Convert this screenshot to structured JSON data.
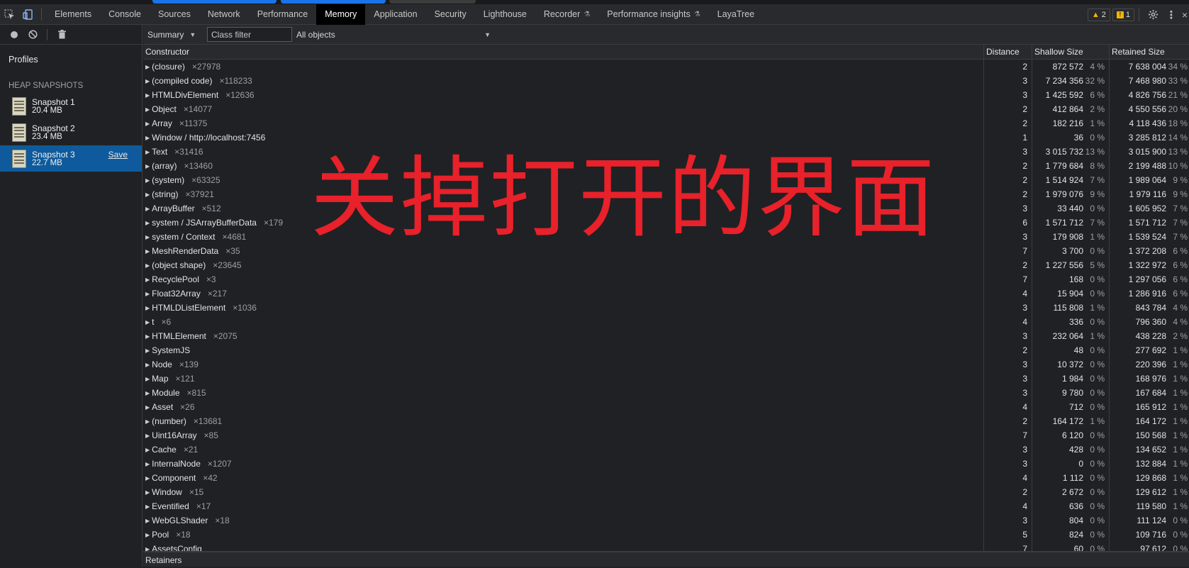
{
  "toolbar": {
    "tabs": [
      {
        "label": "Elements",
        "active": false
      },
      {
        "label": "Console",
        "active": false
      },
      {
        "label": "Sources",
        "active": false
      },
      {
        "label": "Network",
        "active": false
      },
      {
        "label": "Performance",
        "active": false
      },
      {
        "label": "Memory",
        "active": true
      },
      {
        "label": "Application",
        "active": false
      },
      {
        "label": "Security",
        "active": false
      },
      {
        "label": "Lighthouse",
        "active": false
      },
      {
        "label": "Recorder",
        "active": false
      },
      {
        "label": "Performance insights",
        "active": false
      },
      {
        "label": "LayaTree",
        "active": false
      }
    ],
    "warnings_count": "2",
    "issues_count": "1"
  },
  "sidebar": {
    "profiles_title": "Profiles",
    "section_title": "HEAP SNAPSHOTS",
    "snapshots": [
      {
        "name": "Snapshot 1",
        "size": "20.4 MB"
      },
      {
        "name": "Snapshot 2",
        "size": "23.4 MB"
      },
      {
        "name": "Snapshot 3",
        "size": "22.7 MB"
      }
    ],
    "save_label": "Save"
  },
  "filters": {
    "view": "Summary",
    "class_filter_placeholder": "Class filter",
    "objects": "All objects"
  },
  "grid": {
    "headers": {
      "constructor": "Constructor",
      "distance": "Distance",
      "shallow": "Shallow Size",
      "retained": "Retained Size"
    },
    "rows": [
      {
        "name": "(closure)",
        "count": "×27978",
        "distance": "2",
        "shallow": "872 572",
        "shallow_pct": "4 %",
        "retained": "7 638 004",
        "retained_pct": "34 %"
      },
      {
        "name": "(compiled code)",
        "count": "×118233",
        "distance": "3",
        "shallow": "7 234 356",
        "shallow_pct": "32 %",
        "retained": "7 468 980",
        "retained_pct": "33 %"
      },
      {
        "name": "HTMLDivElement",
        "count": "×12636",
        "distance": "3",
        "shallow": "1 425 592",
        "shallow_pct": "6 %",
        "retained": "4 826 756",
        "retained_pct": "21 %"
      },
      {
        "name": "Object",
        "count": "×14077",
        "distance": "2",
        "shallow": "412 864",
        "shallow_pct": "2 %",
        "retained": "4 550 556",
        "retained_pct": "20 %"
      },
      {
        "name": "Array",
        "count": "×11375",
        "distance": "2",
        "shallow": "182 216",
        "shallow_pct": "1 %",
        "retained": "4 118 436",
        "retained_pct": "18 %"
      },
      {
        "name": "Window / http://localhost:7456",
        "count": "",
        "distance": "1",
        "shallow": "36",
        "shallow_pct": "0 %",
        "retained": "3 285 812",
        "retained_pct": "14 %"
      },
      {
        "name": "Text",
        "count": "×31416",
        "distance": "3",
        "shallow": "3 015 732",
        "shallow_pct": "13 %",
        "retained": "3 015 900",
        "retained_pct": "13 %"
      },
      {
        "name": "(array)",
        "count": "×13460",
        "distance": "2",
        "shallow": "1 779 684",
        "shallow_pct": "8 %",
        "retained": "2 199 488",
        "retained_pct": "10 %"
      },
      {
        "name": "(system)",
        "count": "×63325",
        "distance": "2",
        "shallow": "1 514 924",
        "shallow_pct": "7 %",
        "retained": "1 989 064",
        "retained_pct": "9 %"
      },
      {
        "name": "(string)",
        "count": "×37921",
        "distance": "2",
        "shallow": "1 979 076",
        "shallow_pct": "9 %",
        "retained": "1 979 116",
        "retained_pct": "9 %"
      },
      {
        "name": "ArrayBuffer",
        "count": "×512",
        "distance": "3",
        "shallow": "33 440",
        "shallow_pct": "0 %",
        "retained": "1 605 952",
        "retained_pct": "7 %"
      },
      {
        "name": "system / JSArrayBufferData",
        "count": "×179",
        "distance": "6",
        "shallow": "1 571 712",
        "shallow_pct": "7 %",
        "retained": "1 571 712",
        "retained_pct": "7 %"
      },
      {
        "name": "system / Context",
        "count": "×4681",
        "distance": "3",
        "shallow": "179 908",
        "shallow_pct": "1 %",
        "retained": "1 539 524",
        "retained_pct": "7 %"
      },
      {
        "name": "MeshRenderData",
        "count": "×35",
        "distance": "7",
        "shallow": "3 700",
        "shallow_pct": "0 %",
        "retained": "1 372 208",
        "retained_pct": "6 %"
      },
      {
        "name": "(object shape)",
        "count": "×23645",
        "distance": "2",
        "shallow": "1 227 556",
        "shallow_pct": "5 %",
        "retained": "1 322 972",
        "retained_pct": "6 %"
      },
      {
        "name": "RecyclePool",
        "count": "×3",
        "distance": "7",
        "shallow": "168",
        "shallow_pct": "0 %",
        "retained": "1 297 056",
        "retained_pct": "6 %"
      },
      {
        "name": "Float32Array",
        "count": "×217",
        "distance": "4",
        "shallow": "15 904",
        "shallow_pct": "0 %",
        "retained": "1 286 916",
        "retained_pct": "6 %"
      },
      {
        "name": "HTMLDListElement",
        "count": "×1036",
        "distance": "3",
        "shallow": "115 808",
        "shallow_pct": "1 %",
        "retained": "843 784",
        "retained_pct": "4 %"
      },
      {
        "name": "t",
        "count": "×6",
        "distance": "4",
        "shallow": "336",
        "shallow_pct": "0 %",
        "retained": "796 360",
        "retained_pct": "4 %"
      },
      {
        "name": "HTMLElement",
        "count": "×2075",
        "distance": "3",
        "shallow": "232 064",
        "shallow_pct": "1 %",
        "retained": "438 228",
        "retained_pct": "2 %"
      },
      {
        "name": "SystemJS",
        "count": "",
        "distance": "2",
        "shallow": "48",
        "shallow_pct": "0 %",
        "retained": "277 692",
        "retained_pct": "1 %"
      },
      {
        "name": "Node",
        "count": "×139",
        "distance": "3",
        "shallow": "10 372",
        "shallow_pct": "0 %",
        "retained": "220 396",
        "retained_pct": "1 %"
      },
      {
        "name": "Map",
        "count": "×121",
        "distance": "3",
        "shallow": "1 984",
        "shallow_pct": "0 %",
        "retained": "168 976",
        "retained_pct": "1 %"
      },
      {
        "name": "Module",
        "count": "×815",
        "distance": "3",
        "shallow": "9 780",
        "shallow_pct": "0 %",
        "retained": "167 684",
        "retained_pct": "1 %"
      },
      {
        "name": "Asset",
        "count": "×26",
        "distance": "4",
        "shallow": "712",
        "shallow_pct": "0 %",
        "retained": "165 912",
        "retained_pct": "1 %"
      },
      {
        "name": "(number)",
        "count": "×13681",
        "distance": "2",
        "shallow": "164 172",
        "shallow_pct": "1 %",
        "retained": "164 172",
        "retained_pct": "1 %"
      },
      {
        "name": "Uint16Array",
        "count": "×85",
        "distance": "7",
        "shallow": "6 120",
        "shallow_pct": "0 %",
        "retained": "150 568",
        "retained_pct": "1 %"
      },
      {
        "name": "Cache",
        "count": "×21",
        "distance": "3",
        "shallow": "428",
        "shallow_pct": "0 %",
        "retained": "134 652",
        "retained_pct": "1 %"
      },
      {
        "name": "InternalNode",
        "count": "×1207",
        "distance": "3",
        "shallow": "0",
        "shallow_pct": "0 %",
        "retained": "132 884",
        "retained_pct": "1 %"
      },
      {
        "name": "Component",
        "count": "×42",
        "distance": "4",
        "shallow": "1 112",
        "shallow_pct": "0 %",
        "retained": "129 868",
        "retained_pct": "1 %"
      },
      {
        "name": "Window",
        "count": "×15",
        "distance": "2",
        "shallow": "2 672",
        "shallow_pct": "0 %",
        "retained": "129 612",
        "retained_pct": "1 %"
      },
      {
        "name": "Eventified",
        "count": "×17",
        "distance": "4",
        "shallow": "636",
        "shallow_pct": "0 %",
        "retained": "119 580",
        "retained_pct": "1 %"
      },
      {
        "name": "WebGLShader",
        "count": "×18",
        "distance": "3",
        "shallow": "804",
        "shallow_pct": "0 %",
        "retained": "111 124",
        "retained_pct": "0 %"
      },
      {
        "name": "Pool",
        "count": "×18",
        "distance": "5",
        "shallow": "824",
        "shallow_pct": "0 %",
        "retained": "109 716",
        "retained_pct": "0 %"
      },
      {
        "name": "AssetsConfig",
        "count": "",
        "distance": "7",
        "shallow": "60",
        "shallow_pct": "0 %",
        "retained": "97 612",
        "retained_pct": "0 %"
      }
    ]
  },
  "retainers_label": "Retainers",
  "overlay_text": "关掉打开的界面",
  "colors": {
    "accent": "#0e5a9c",
    "overlay": "#e8212a"
  }
}
